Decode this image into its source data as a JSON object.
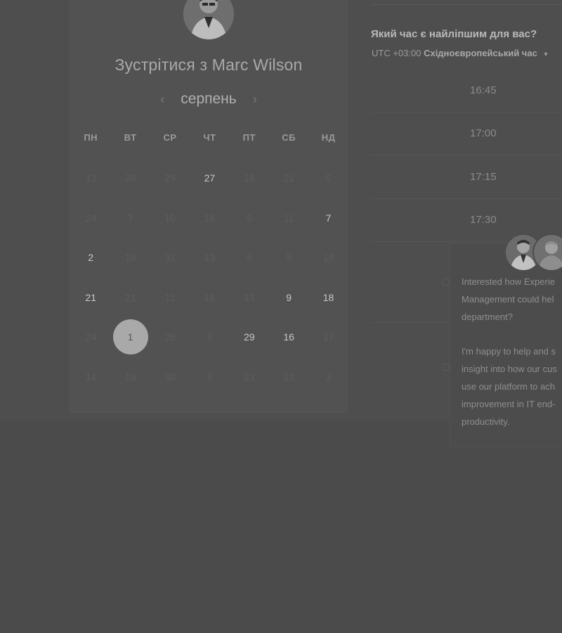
{
  "host": {
    "title": "Зустрітися з Marc Wilson",
    "avatar_icon": "person-avatar-icon"
  },
  "calendar": {
    "month": "серпень",
    "prev_icon": "chevron-left-icon",
    "next_icon": "chevron-right-icon",
    "weekdays": [
      "ПН",
      "ВТ",
      "СР",
      "ЧТ",
      "ПТ",
      "СБ",
      "НД"
    ],
    "weeks": [
      [
        {
          "d": "13",
          "a": false
        },
        {
          "d": "28",
          "a": false
        },
        {
          "d": "29",
          "a": false
        },
        {
          "d": "27",
          "a": true
        },
        {
          "d": "18",
          "a": false
        },
        {
          "d": "21",
          "a": false
        },
        {
          "d": "5",
          "a": false
        }
      ],
      [
        {
          "d": "24",
          "a": false
        },
        {
          "d": "7",
          "a": false
        },
        {
          "d": "10",
          "a": false
        },
        {
          "d": "18",
          "a": false
        },
        {
          "d": "5",
          "a": false
        },
        {
          "d": "11",
          "a": false
        },
        {
          "d": "7",
          "a": true
        }
      ],
      [
        {
          "d": "2",
          "a": true
        },
        {
          "d": "18",
          "a": false
        },
        {
          "d": "31",
          "a": false
        },
        {
          "d": "13",
          "a": false
        },
        {
          "d": "5",
          "a": false
        },
        {
          "d": "5",
          "a": false
        },
        {
          "d": "19",
          "a": false
        }
      ],
      [
        {
          "d": "21",
          "a": true
        },
        {
          "d": "21",
          "a": false
        },
        {
          "d": "11",
          "a": false
        },
        {
          "d": "16",
          "a": false
        },
        {
          "d": "13",
          "a": false
        },
        {
          "d": "9",
          "a": true
        },
        {
          "d": "18",
          "a": true
        }
      ],
      [
        {
          "d": "24",
          "a": false
        },
        {
          "d": "1",
          "a": true,
          "sel": true
        },
        {
          "d": "26",
          "a": false
        },
        {
          "d": "9",
          "a": false
        },
        {
          "d": "29",
          "a": true
        },
        {
          "d": "16",
          "a": true
        },
        {
          "d": "17",
          "a": false
        }
      ],
      [
        {
          "d": "14",
          "a": false
        },
        {
          "d": "19",
          "a": false
        },
        {
          "d": "30",
          "a": false
        },
        {
          "d": "9",
          "a": false
        },
        {
          "d": "23",
          "a": false
        },
        {
          "d": "23",
          "a": false
        },
        {
          "d": "3",
          "a": false
        }
      ]
    ]
  },
  "times": {
    "heading": "Який час є найліпшим для вас?",
    "tz_offset": "UTC +03:00",
    "tz_name": "Східноєвропейський час",
    "tz_caret_icon": "caret-down-icon",
    "slots": [
      "16:45",
      "17:00",
      "17:15",
      "17:30"
    ]
  },
  "chat": {
    "lines_1": [
      "Interested how Experie",
      "Management could hel",
      "department?"
    ],
    "lines_2": [
      "I'm happy to help and s",
      "insight into how our cus",
      "use our platform to ach",
      "improvement in IT end-",
      "productivity."
    ]
  }
}
